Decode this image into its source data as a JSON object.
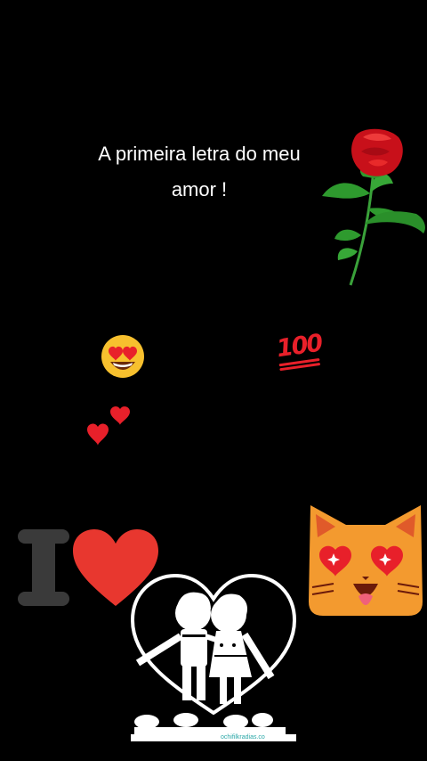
{
  "caption": {
    "line1": "A primeira letra do meu",
    "line2": "amor !"
  },
  "stickers": {
    "hundred_text": "100",
    "letter_i": "I",
    "watermark": "ochifilkradias.co"
  },
  "icons": [
    "rose-icon",
    "heart-eyes-emoji-icon",
    "hundred-points-icon",
    "two-hearts-icon",
    "letter-i-icon",
    "red-heart-icon",
    "heart-eyes-cat-icon",
    "kissing-couple-heart-icon"
  ],
  "colors": {
    "background": "#000000",
    "text": "#ffffff",
    "heart_red": "#e8372f",
    "cat_orange": "#f39a2f",
    "rose_red": "#c8101a",
    "leaf_green": "#2e9a2e"
  }
}
